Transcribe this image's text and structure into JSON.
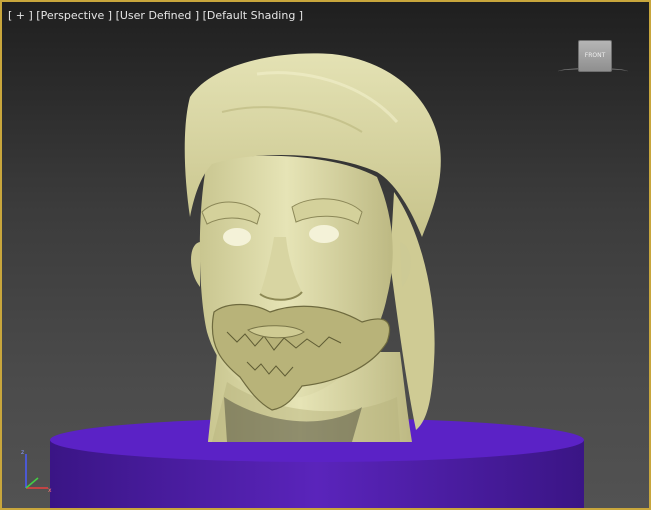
{
  "viewport": {
    "label_plus": "[ + ]",
    "label_view": "[Perspective ]",
    "label_lighting": "[User Defined ]",
    "label_shading": "[Default Shading ]"
  },
  "viewcube": {
    "face_label": "FRONT"
  },
  "colors": {
    "viewport_border": "#c8a63c",
    "model_skin": "#dedca8",
    "pedestal": "#4a1d9c",
    "background_top": "#1f1f1f",
    "background_bottom": "#525252"
  },
  "icons": [
    "viewcube-icon",
    "axis-tripod-icon"
  ]
}
